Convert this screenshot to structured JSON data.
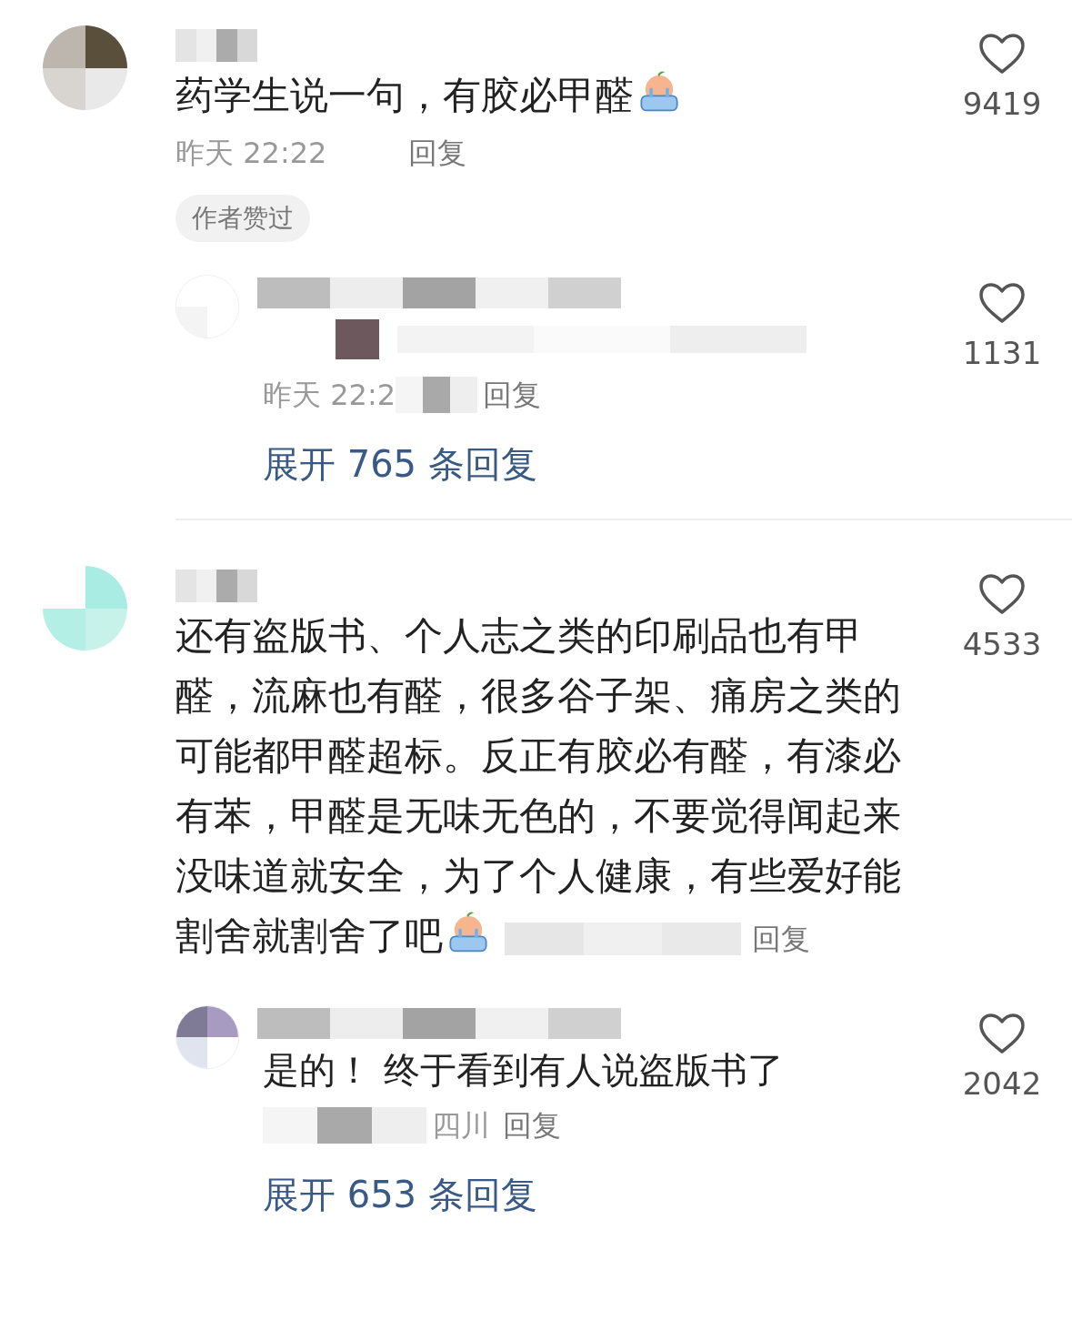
{
  "comments": [
    {
      "text": "药学生说一句，有胶必甲醛",
      "emoji": true,
      "likes": "9419",
      "time": "昨天 22:22",
      "reply_label": "回复",
      "meta_inline": false,
      "badge": "作者赞过",
      "replies": [
        {
          "likes": "1131",
          "time": "昨天 22:2",
          "reply_label": "回复"
        }
      ],
      "expand": "展开 765 条回复"
    },
    {
      "text": "还有盗版书、个人志之类的印刷品也有甲醛，流麻也有醛，很多谷子架、痛房之类的可能都甲醛超标。反正有胶必有醛，有漆必有苯，甲醛是无味无色的，不要觉得闻起来没味道就安全，为了个人健康，有些爱好能割舍就割舍了吧",
      "emoji": true,
      "likes": "4533",
      "reply_label": "回复",
      "meta_inline": true,
      "replies": [
        {
          "text": "是的！ 终于看到有人说盗版书了",
          "likes": "2042",
          "location": "四川",
          "reply_label": "回复"
        }
      ],
      "expand": "展开 653 条回复"
    }
  ]
}
